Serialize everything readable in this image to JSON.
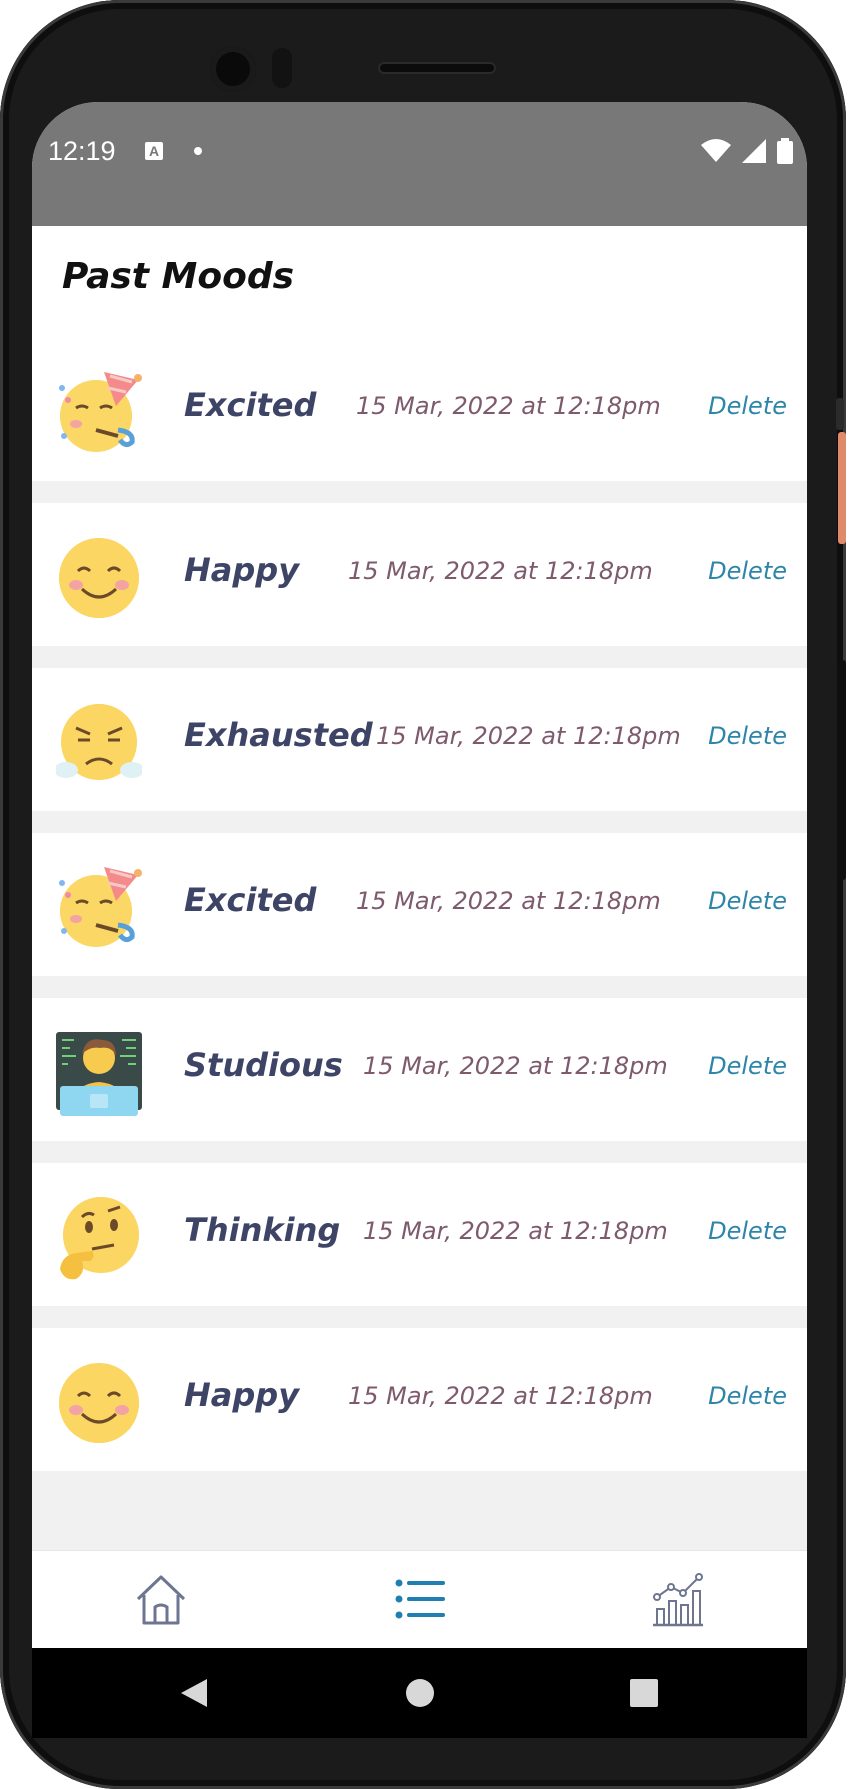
{
  "status_bar": {
    "time": "12:19",
    "notification_icon": "A"
  },
  "header": {
    "title": "Past Moods"
  },
  "moods": [
    {
      "emoji": "party-face-icon",
      "label": "Excited",
      "date": "15 Mar, 2022 at 12:18pm",
      "delete_label": "Delete"
    },
    {
      "emoji": "smiling-face-icon",
      "label": "Happy",
      "date": "15 Mar, 2022 at 12:18pm",
      "delete_label": "Delete"
    },
    {
      "emoji": "steam-nose-face-icon",
      "label": "Exhausted",
      "date": "15 Mar, 2022 at 12:18pm",
      "delete_label": "Delete"
    },
    {
      "emoji": "party-face-icon",
      "label": "Excited",
      "date": "15 Mar, 2022 at 12:18pm",
      "delete_label": "Delete"
    },
    {
      "emoji": "technologist-icon",
      "label": "Studious",
      "date": "15 Mar, 2022 at 12:18pm",
      "delete_label": "Delete"
    },
    {
      "emoji": "thinking-face-icon",
      "label": "Thinking",
      "date": "15 Mar, 2022 at 12:18pm",
      "delete_label": "Delete"
    },
    {
      "emoji": "smiling-face-icon",
      "label": "Happy",
      "date": "15 Mar, 2022 at 12:18pm",
      "delete_label": "Delete"
    }
  ],
  "bottom_nav": {
    "items": [
      {
        "icon": "home-icon",
        "active": false
      },
      {
        "icon": "list-icon",
        "active": true
      },
      {
        "icon": "chart-icon",
        "active": false
      }
    ]
  },
  "colors": {
    "status_bar": "#787878",
    "mood_label": "#3d4466",
    "date_text": "#7d5a6c",
    "delete_link": "#2d86a8",
    "nav_active": "#1f7fb0",
    "nav_inactive": "#6d7590"
  }
}
